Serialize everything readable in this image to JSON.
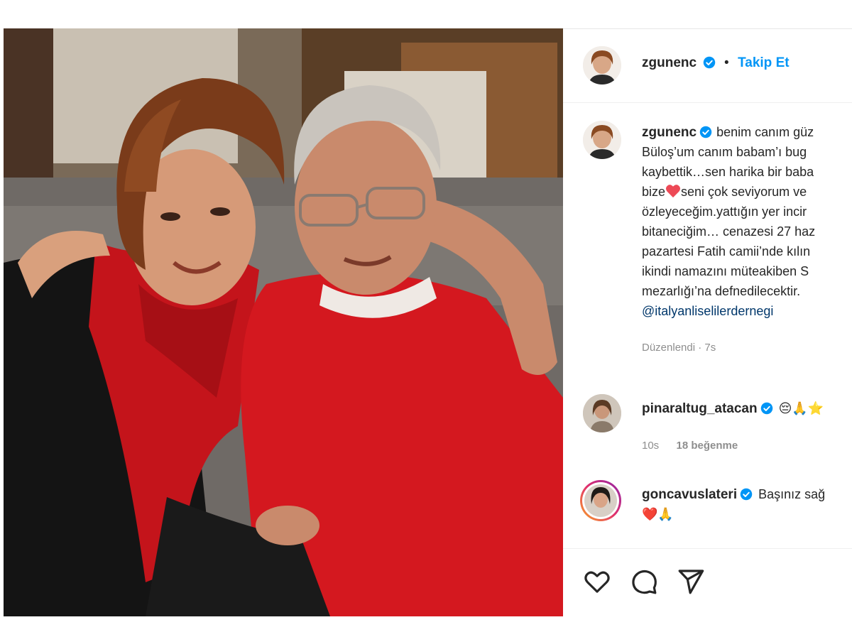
{
  "post": {
    "author": {
      "username": "zgunenc",
      "verified": true,
      "follow_label": "Takip Et",
      "separator": "•"
    },
    "caption": {
      "username": "zgunenc",
      "lines": [
        "benim canım güz",
        "Büloş’um canım babam’ı bug",
        "kaybettik…sen harika bir baba",
        "bize",
        "seni çok seviyorum ve",
        "özleyeceğim.yattığın yer incir",
        "bitaneciğim… cenazesi 27 haz",
        "pazartesi Fatih camii’nde kılın",
        "ikindi namazını müteakiben S",
        "mezarlığı’na defnedilecektir."
      ],
      "mention": "@italyanliselilerdernegi",
      "meta": "Düzenlendi · 7s"
    },
    "comments": [
      {
        "username": "pinaraltug_atacan",
        "verified": true,
        "text": "😔🙏⭐",
        "time": "10s",
        "likes": "18 beğenme"
      },
      {
        "username": "goncavuslateri",
        "verified": true,
        "text": "Başınız sağ",
        "text2": "❤️🙏"
      }
    ],
    "actions": [
      {
        "name": "like-icon"
      },
      {
        "name": "comment-icon"
      },
      {
        "name": "share-icon"
      }
    ]
  },
  "colors": {
    "accent": "#0095f6",
    "verified": "#0095f6",
    "heart": "#ed4956",
    "text": "#262626",
    "muted": "#8e8e8e"
  }
}
